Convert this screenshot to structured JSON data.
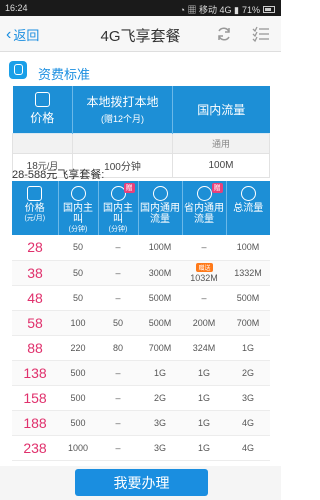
{
  "status_bar": {
    "time": "16:24",
    "indicators": "◔ ▦ 移动 4G ▮",
    "battery": "71%"
  },
  "nav": {
    "back_label": "返回",
    "title": "4G飞享套餐",
    "refresh_icon": "refresh-icon",
    "menu_icon": "checklist-menu-icon"
  },
  "fee_section": {
    "title": "资费标准",
    "headers": {
      "price": "价格",
      "local_call": "本地拨打本地",
      "local_call_sub": "(赠12个月)",
      "domestic_data": "国内流量",
      "domestic_data_sub": "通用"
    },
    "row": {
      "price": "18",
      "price_unit": "元/月",
      "minutes": "100分钟",
      "data": "100M"
    }
  },
  "package": {
    "title": "28-588元飞享套餐:",
    "headers": [
      {
        "label": "价格",
        "unit": "(元/月)"
      },
      {
        "label": "国内主叫",
        "unit": "(分钟)"
      },
      {
        "label": "国内主叫",
        "unit": "(分钟)",
        "badge": "赠"
      },
      {
        "label": "国内通用流量",
        "unit": ""
      },
      {
        "label": "省内通用流量",
        "unit": "",
        "badge": "赠"
      },
      {
        "label": "总流量",
        "unit": ""
      }
    ],
    "bonus_label": "赠送",
    "rows": [
      {
        "price": "28",
        "calls": "50",
        "bonus_calls": "–",
        "national_data": "100M",
        "province_data": "–",
        "total": "100M"
      },
      {
        "price": "38",
        "calls": "50",
        "bonus_calls": "–",
        "national_data": "300M",
        "province_data": "1032M",
        "total": "1332M"
      },
      {
        "price": "48",
        "calls": "50",
        "bonus_calls": "–",
        "national_data": "500M",
        "province_data": "–",
        "total": "500M"
      },
      {
        "price": "58",
        "calls": "100",
        "bonus_calls": "50",
        "national_data": "500M",
        "province_data": "200M",
        "total": "700M"
      },
      {
        "price": "88",
        "calls": "220",
        "bonus_calls": "80",
        "national_data": "700M",
        "province_data": "324M",
        "total": "1G"
      },
      {
        "price": "138",
        "calls": "500",
        "bonus_calls": "–",
        "national_data": "1G",
        "province_data": "1G",
        "total": "2G"
      },
      {
        "price": "158",
        "calls": "500",
        "bonus_calls": "–",
        "national_data": "2G",
        "province_data": "1G",
        "total": "3G"
      },
      {
        "price": "188",
        "calls": "500",
        "bonus_calls": "–",
        "national_data": "3G",
        "province_data": "1G",
        "total": "4G"
      },
      {
        "price": "238",
        "calls": "1000",
        "bonus_calls": "–",
        "national_data": "3G",
        "province_data": "1G",
        "total": "4G"
      }
    ]
  },
  "bottom": {
    "apply_label": "我要办理"
  },
  "colors": {
    "accent": "#1a8ee0",
    "header_blue": "#1d8fd6",
    "price_pink": "#e0306c",
    "badge_pink": "#e8407a",
    "bonus_orange": "#ff7a1a"
  }
}
